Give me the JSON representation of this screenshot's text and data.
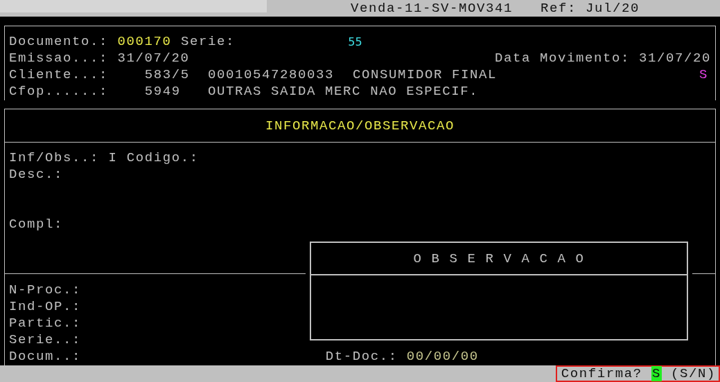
{
  "title_bar": {
    "title": "Venda-11-SV-MOV341",
    "ref": "Ref: Jul/20"
  },
  "header": {
    "documento": {
      "label": "Documento.:",
      "value": "000170"
    },
    "serie": {
      "label": "Serie:",
      "value": "55"
    },
    "emissao": {
      "label": "Emissao...:",
      "value": "31/07/20"
    },
    "data_movimento": {
      "label": "Data Movimento:",
      "value": "31/07/20"
    },
    "cliente": {
      "label": "Cliente...:",
      "code": "583/5",
      "document": "00010547280033",
      "name": "CONSUMIDOR FINAL",
      "flag": "S"
    },
    "cfop": {
      "label": "Cfop......:",
      "code": "5949",
      "description": "OUTRAS SAIDA MERC NAO ESPECIF."
    }
  },
  "info_panel": {
    "title": "INFORMACAO/OBSERVACAO",
    "inf_obs": {
      "label": "Inf/Obs..:",
      "value": "I",
      "codigo_label": "Codigo.:"
    },
    "desc": {
      "label": "Desc.:"
    },
    "compl": {
      "label": "Compl:"
    },
    "lower_fields": [
      {
        "label": "N-Proc.:"
      },
      {
        "label": "Ind-OP.:"
      },
      {
        "label": "Partic.:"
      },
      {
        "label": "Serie..:"
      },
      {
        "label": "Docum..:"
      }
    ],
    "dt_doc": {
      "label": "Dt-Doc.:",
      "value": "00/00/00"
    }
  },
  "observacao_popup": {
    "title": "O B S E R V A C A O"
  },
  "status_bar": {
    "prompt": "Confirma?",
    "answer": "S",
    "options": "(S/N)"
  }
}
